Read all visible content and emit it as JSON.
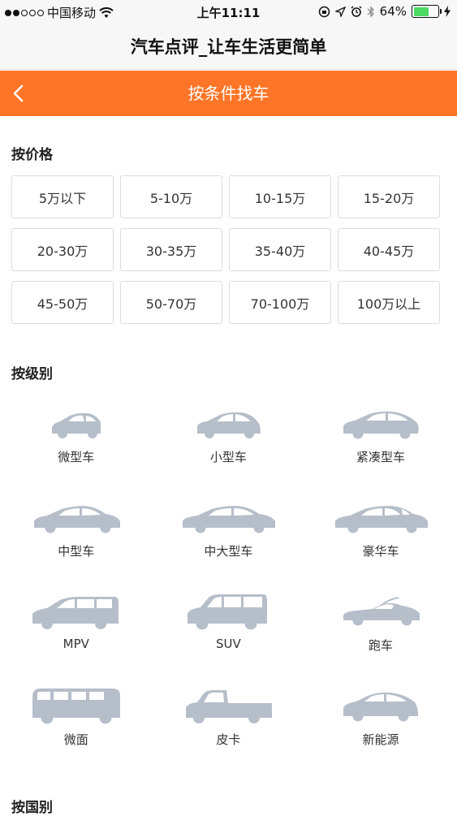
{
  "status_bar": {
    "carrier": "中国移动",
    "time": "上午11:11",
    "battery": "64%",
    "battery_level": 0.64
  },
  "site_title": "汽车点评_让车生活更简单",
  "nav": {
    "title": "按条件找车"
  },
  "price_section": {
    "title": "按价格",
    "options": [
      "5万以下",
      "5-10万",
      "10-15万",
      "15-20万",
      "20-30万",
      "30-35万",
      "35-40万",
      "40-45万",
      "45-50万",
      "50-70万",
      "70-100万",
      "100万以上"
    ]
  },
  "level_section": {
    "title": "按级别",
    "items": [
      {
        "label": "微型车",
        "icon": "mini-car-icon"
      },
      {
        "label": "小型车",
        "icon": "small-car-icon"
      },
      {
        "label": "紧凑型车",
        "icon": "compact-car-icon"
      },
      {
        "label": "中型车",
        "icon": "midsize-car-icon"
      },
      {
        "label": "中大型车",
        "icon": "large-car-icon"
      },
      {
        "label": "豪华车",
        "icon": "luxury-car-icon"
      },
      {
        "label": "MPV",
        "icon": "mpv-icon"
      },
      {
        "label": "SUV",
        "icon": "suv-icon"
      },
      {
        "label": "跑车",
        "icon": "sports-car-icon"
      },
      {
        "label": "微面",
        "icon": "minivan-icon"
      },
      {
        "label": "皮卡",
        "icon": "pickup-icon"
      },
      {
        "label": "新能源",
        "icon": "new-energy-car-icon"
      }
    ]
  },
  "country_section": {
    "title": "按国别"
  },
  "colors": {
    "accent": "#ff7528",
    "icon_gray": "#b5bec9"
  }
}
